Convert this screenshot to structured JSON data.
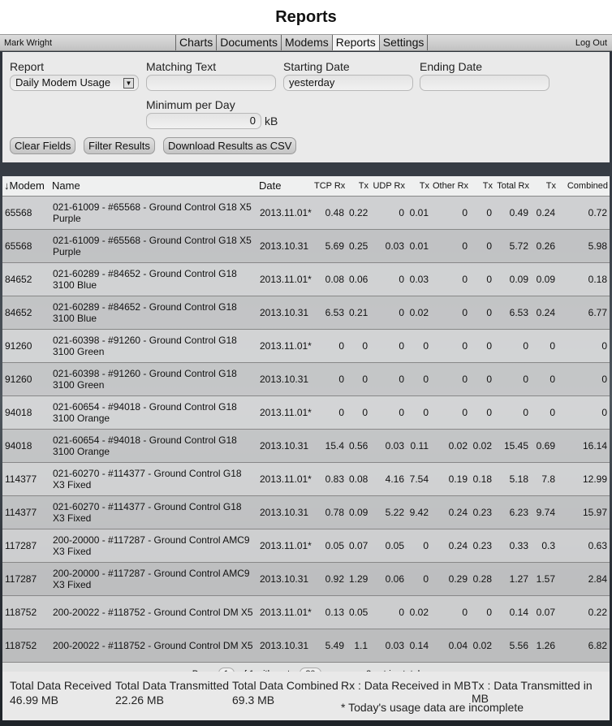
{
  "app": {
    "title": "Reports"
  },
  "nav": {
    "user": "Mark Wright",
    "tabs": [
      "Charts",
      "Documents",
      "Modems",
      "Reports",
      "Settings"
    ],
    "active_tab": "Reports",
    "logout": "Log Out"
  },
  "filters": {
    "report_label": "Report",
    "report_value": "Daily Modem Usage",
    "matching_label": "Matching Text",
    "matching_value": "",
    "start_label": "Starting Date",
    "start_value": "yesterday",
    "end_label": "Ending Date",
    "end_value": "",
    "min_label": "Minimum per Day",
    "min_value": "0",
    "min_unit": "kB",
    "clear_button": "Clear Fields",
    "filter_button": "Filter Results",
    "download_button": "Download Results as CSV"
  },
  "table": {
    "headers": {
      "modem": "↓Modem",
      "name": "Name",
      "date": "Date",
      "tcp_rx": "TCP Rx",
      "tcp_tx": "Tx",
      "udp_rx": "UDP Rx",
      "udp_tx": "Tx",
      "other_rx": "Other Rx",
      "other_tx": "Tx",
      "total_rx": "Total Rx",
      "total_tx": "Tx",
      "combined": "Combined"
    },
    "rows": [
      {
        "modem": "65568",
        "name": "021-61009 - #65568 - Ground Control G18 X5 Purple",
        "date": "2013.11.01*",
        "tcp_rx": "0.48",
        "tcp_tx": "0.22",
        "udp_rx": "0",
        "udp_tx": "0.01",
        "other_rx": "0",
        "other_tx": "0",
        "total_rx": "0.49",
        "total_tx": "0.24",
        "combined": "0.72"
      },
      {
        "modem": "65568",
        "name": "021-61009 - #65568 - Ground Control G18 X5 Purple",
        "date": "2013.10.31",
        "tcp_rx": "5.69",
        "tcp_tx": "0.25",
        "udp_rx": "0.03",
        "udp_tx": "0.01",
        "other_rx": "0",
        "other_tx": "0",
        "total_rx": "5.72",
        "total_tx": "0.26",
        "combined": "5.98"
      },
      {
        "modem": "84652",
        "name": "021-60289 - #84652 - Ground Control G18 3100 Blue",
        "date": "2013.11.01*",
        "tcp_rx": "0.08",
        "tcp_tx": "0.06",
        "udp_rx": "0",
        "udp_tx": "0.03",
        "other_rx": "0",
        "other_tx": "0",
        "total_rx": "0.09",
        "total_tx": "0.09",
        "combined": "0.18"
      },
      {
        "modem": "84652",
        "name": "021-60289 - #84652 - Ground Control G18 3100 Blue",
        "date": "2013.10.31",
        "tcp_rx": "6.53",
        "tcp_tx": "0.21",
        "udp_rx": "0",
        "udp_tx": "0.02",
        "other_rx": "0",
        "other_tx": "0",
        "total_rx": "6.53",
        "total_tx": "0.24",
        "combined": "6.77"
      },
      {
        "modem": "91260",
        "name": "021-60398 - #91260 - Ground Control G18 3100 Green",
        "date": "2013.11.01*",
        "tcp_rx": "0",
        "tcp_tx": "0",
        "udp_rx": "0",
        "udp_tx": "0",
        "other_rx": "0",
        "other_tx": "0",
        "total_rx": "0",
        "total_tx": "0",
        "combined": "0"
      },
      {
        "modem": "91260",
        "name": "021-60398 - #91260 - Ground Control G18 3100 Green",
        "date": "2013.10.31",
        "tcp_rx": "0",
        "tcp_tx": "0",
        "udp_rx": "0",
        "udp_tx": "0",
        "other_rx": "0",
        "other_tx": "0",
        "total_rx": "0",
        "total_tx": "0",
        "combined": "0"
      },
      {
        "modem": "94018",
        "name": "021-60654 - #94018 - Ground Control G18 3100 Orange",
        "date": "2013.11.01*",
        "tcp_rx": "0",
        "tcp_tx": "0",
        "udp_rx": "0",
        "udp_tx": "0",
        "other_rx": "0",
        "other_tx": "0",
        "total_rx": "0",
        "total_tx": "0",
        "combined": "0"
      },
      {
        "modem": "94018",
        "name": "021-60654 - #94018 - Ground Control G18 3100 Orange",
        "date": "2013.10.31",
        "tcp_rx": "15.4",
        "tcp_tx": "0.56",
        "udp_rx": "0.03",
        "udp_tx": "0.11",
        "other_rx": "0.02",
        "other_tx": "0.02",
        "total_rx": "15.45",
        "total_tx": "0.69",
        "combined": "16.14"
      },
      {
        "modem": "114377",
        "name": "021-60270 - #114377 - Ground Control G18 X3 Fixed",
        "date": "2013.11.01*",
        "tcp_rx": "0.83",
        "tcp_tx": "0.08",
        "udp_rx": "4.16",
        "udp_tx": "7.54",
        "other_rx": "0.19",
        "other_tx": "0.18",
        "total_rx": "5.18",
        "total_tx": "7.8",
        "combined": "12.99"
      },
      {
        "modem": "114377",
        "name": "021-60270 - #114377 - Ground Control G18 X3 Fixed",
        "date": "2013.10.31",
        "tcp_rx": "0.78",
        "tcp_tx": "0.09",
        "udp_rx": "5.22",
        "udp_tx": "9.42",
        "other_rx": "0.24",
        "other_tx": "0.23",
        "total_rx": "6.23",
        "total_tx": "9.74",
        "combined": "15.97"
      },
      {
        "modem": "117287",
        "name": "200-20000 - #117287 - Ground Control AMC9 X3 Fixed",
        "date": "2013.11.01*",
        "tcp_rx": "0.05",
        "tcp_tx": "0.07",
        "udp_rx": "0.05",
        "udp_tx": "0",
        "other_rx": "0.24",
        "other_tx": "0.23",
        "total_rx": "0.33",
        "total_tx": "0.3",
        "combined": "0.63"
      },
      {
        "modem": "117287",
        "name": "200-20000 - #117287 - Ground Control AMC9 X3 Fixed",
        "date": "2013.10.31",
        "tcp_rx": "0.92",
        "tcp_tx": "1.29",
        "udp_rx": "0.06",
        "udp_tx": "0",
        "other_rx": "0.29",
        "other_tx": "0.28",
        "total_rx": "1.27",
        "total_tx": "1.57",
        "combined": "2.84"
      },
      {
        "modem": "118752",
        "name": "200-20022 - #118752 - Ground Control DM X5",
        "date": "2013.11.01*",
        "tcp_rx": "0.13",
        "tcp_tx": "0.05",
        "udp_rx": "0",
        "udp_tx": "0.02",
        "other_rx": "0",
        "other_tx": "0",
        "total_rx": "0.14",
        "total_tx": "0.07",
        "combined": "0.22"
      },
      {
        "modem": "118752",
        "name": "200-20022 - #118752 - Ground Control DM X5",
        "date": "2013.10.31",
        "tcp_rx": "5.49",
        "tcp_tx": "1.1",
        "udp_rx": "0.03",
        "udp_tx": "0.14",
        "other_rx": "0.04",
        "other_tx": "0.02",
        "total_rx": "5.56",
        "total_tx": "1.26",
        "combined": "6.82"
      }
    ]
  },
  "pager": {
    "page_label": "Page",
    "page_value": "1",
    "of_text": "of 1 with up to",
    "per_page_value": "20",
    "suffix": "per page, 2 entries total"
  },
  "summary": {
    "received_label": "Total Data Received",
    "received_value": "46.99 MB",
    "transmitted_label": "Total Data Transmitted",
    "transmitted_value": "22.26 MB",
    "combined_label": "Total Data Combined",
    "combined_value": "69.3 MB",
    "rx_legend": "Rx : Data Received in MB",
    "tx_legend": "Tx : Data Transmitted in MB",
    "note": "* Today's usage data are incomplete"
  }
}
